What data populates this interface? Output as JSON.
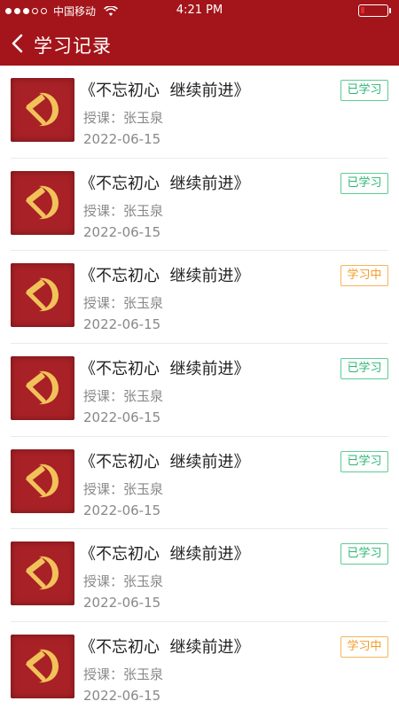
{
  "status_bar": {
    "carrier": "中国移动",
    "time": "4:21 PM"
  },
  "nav": {
    "title": "学习记录"
  },
  "records": [
    {
      "title": "《不忘初心  继续前进》",
      "teacher": "授课：张玉泉",
      "date": "2022-06-15",
      "status": "已学习",
      "state": "done"
    },
    {
      "title": "《不忘初心  继续前进》",
      "teacher": "授课：张玉泉",
      "date": "2022-06-15",
      "status": "已学习",
      "state": "done"
    },
    {
      "title": "《不忘初心  继续前进》",
      "teacher": "授课：张玉泉",
      "date": "2022-06-15",
      "status": "学习中",
      "state": "ongoing"
    },
    {
      "title": "《不忘初心  继续前进》",
      "teacher": "授课：张玉泉",
      "date": "2022-06-15",
      "status": "已学习",
      "state": "done"
    },
    {
      "title": "《不忘初心  继续前进》",
      "teacher": "授课：张玉泉",
      "date": "2022-06-15",
      "status": "已学习",
      "state": "done"
    },
    {
      "title": "《不忘初心  继续前进》",
      "teacher": "授课：张玉泉",
      "date": "2022-06-15",
      "status": "已学习",
      "state": "done"
    },
    {
      "title": "《不忘初心  继续前进》",
      "teacher": "授课：张玉泉",
      "date": "2022-06-15",
      "status": "学习中",
      "state": "ongoing"
    }
  ],
  "colors": {
    "header": "#a3151a",
    "done": "#2bb673",
    "ongoing": "#f39b27"
  }
}
